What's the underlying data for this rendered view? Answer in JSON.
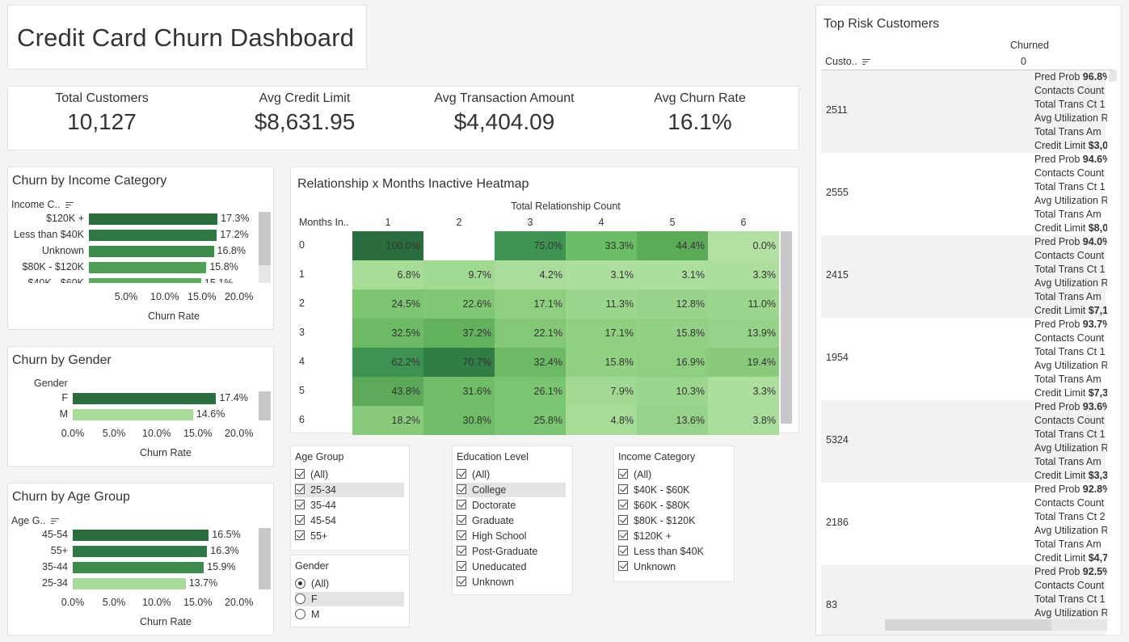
{
  "header": {
    "title": "Credit Card Churn Dashboard"
  },
  "kpis": [
    {
      "label": "Total Customers",
      "value": "10,127"
    },
    {
      "label": "Avg Credit Limit",
      "value": "$8,631.95"
    },
    {
      "label": "Avg Transaction Amount",
      "value": "$4,404.09"
    },
    {
      "label": "Avg Churn Rate",
      "value": "16.1%"
    }
  ],
  "income_chart": {
    "title": "Churn by Income Category",
    "dim_header": "Income C..",
    "axis_title": "Churn Rate",
    "ticks": [
      "5.0%",
      "10.0%",
      "15.0%",
      "20.0%"
    ],
    "rows": [
      {
        "label": "$120K +",
        "value": 17.3,
        "text": "17.3%",
        "color": "#2a6e3f"
      },
      {
        "label": "Less than $40K",
        "value": 17.2,
        "text": "17.2%",
        "color": "#2f7a44"
      },
      {
        "label": "Unknown",
        "value": 16.8,
        "text": "16.8%",
        "color": "#3c8c4b"
      },
      {
        "label": "$80K - $120K",
        "value": 15.8,
        "text": "15.8%",
        "color": "#4f9e55"
      },
      {
        "label": "$40K - $60K",
        "value": 15.1,
        "text": "15.1%",
        "color": "#5dab5e"
      }
    ]
  },
  "gender_chart": {
    "title": "Churn by Gender",
    "dim_header": "Gender",
    "axis_title": "Churn Rate",
    "ticks": [
      "0.0%",
      "5.0%",
      "10.0%",
      "15.0%",
      "20.0%"
    ],
    "rows": [
      {
        "label": "F",
        "value": 17.4,
        "text": "17.4%",
        "color": "#2a6e3f"
      },
      {
        "label": "M",
        "value": 14.6,
        "text": "14.6%",
        "color": "#a8dc9a"
      }
    ]
  },
  "age_chart": {
    "title": "Churn by Age Group",
    "dim_header": "Age G..",
    "axis_title": "Churn Rate",
    "ticks": [
      "0.0%",
      "5.0%",
      "10.0%",
      "15.0%",
      "20.0%"
    ],
    "rows": [
      {
        "label": "45-54",
        "value": 16.5,
        "text": "16.5%",
        "color": "#2a6e3f"
      },
      {
        "label": "55+",
        "value": 16.3,
        "text": "16.3%",
        "color": "#2f7a44"
      },
      {
        "label": "35-44",
        "value": 15.9,
        "text": "15.9%",
        "color": "#3c8c4b"
      },
      {
        "label": "25-34",
        "value": 13.7,
        "text": "13.7%",
        "color": "#a8dc9a"
      }
    ]
  },
  "heatmap": {
    "title": "Relationship x Months Inactive Heatmap",
    "col_title": "Total Relationship Count",
    "row_header": "Months In..",
    "columns": [
      "1",
      "2",
      "3",
      "4",
      "5",
      "6"
    ],
    "rows": [
      {
        "label": "0",
        "cells": [
          "100.0%",
          "",
          "75.0%",
          "33.3%",
          "44.4%",
          "0.0%"
        ]
      },
      {
        "label": "1",
        "cells": [
          "6.8%",
          "9.7%",
          "4.2%",
          "3.1%",
          "3.1%",
          "3.3%"
        ]
      },
      {
        "label": "2",
        "cells": [
          "24.5%",
          "22.6%",
          "17.1%",
          "11.3%",
          "12.8%",
          "11.0%"
        ]
      },
      {
        "label": "3",
        "cells": [
          "32.5%",
          "37.2%",
          "22.1%",
          "17.1%",
          "15.8%",
          "13.9%"
        ]
      },
      {
        "label": "4",
        "cells": [
          "62.2%",
          "70.7%",
          "32.4%",
          "15.8%",
          "16.9%",
          "19.4%"
        ]
      },
      {
        "label": "5",
        "cells": [
          "43.8%",
          "31.6%",
          "26.1%",
          "7.9%",
          "10.3%",
          "3.3%"
        ]
      },
      {
        "label": "6",
        "cells": [
          "18.2%",
          "30.8%",
          "25.8%",
          "4.8%",
          "13.6%",
          "3.8%"
        ]
      }
    ],
    "colors": [
      [
        "#2a6e3f",
        "#ffffff",
        "#3c9450",
        "#6cbe66",
        "#5aab58",
        "#b2e0a3"
      ],
      [
        "#a6dc96",
        "#a0d990",
        "#aadd9b",
        "#acde9d",
        "#acde9d",
        "#acde9d"
      ],
      [
        "#7cc671",
        "#80c873",
        "#8ecf80",
        "#9cd68d",
        "#98d48a",
        "#9cd68d"
      ],
      [
        "#6cba63",
        "#62b15c",
        "#82c875",
        "#8ecf80",
        "#92d184",
        "#96d388"
      ],
      [
        "#3c9450",
        "#2f7f45",
        "#6cba63",
        "#92d184",
        "#8ecf80",
        "#88cc7b"
      ],
      [
        "#5caa59",
        "#70bd68",
        "#7ac570",
        "#a2da93",
        "#9cd68d",
        "#acde9d"
      ],
      [
        "#88cc7b",
        "#70bd68",
        "#7ac570",
        "#a6dc96",
        "#96d388",
        "#aadd9b"
      ]
    ]
  },
  "filters": {
    "age": {
      "title": "Age Group",
      "items": [
        "(All)",
        "25-34",
        "35-44",
        "45-54",
        "55+"
      ]
    },
    "gender": {
      "title": "Gender",
      "items": [
        "(All)",
        "F",
        "M"
      ]
    },
    "education": {
      "title": "Education Level",
      "items": [
        "(All)",
        "College",
        "Doctorate",
        "Graduate",
        "High School",
        "Post-Graduate",
        "Uneducated",
        "Unknown"
      ]
    },
    "income": {
      "title": "Income Category",
      "items": [
        "(All)",
        "$40K - $60K",
        "$60K - $80K",
        "$80K - $120K",
        "$120K +",
        "Less than $40K",
        "Unknown"
      ]
    }
  },
  "risk": {
    "title": "Top Risk Customers",
    "col_header": "Churned",
    "col_value": "0",
    "row_header": "Custo..",
    "customers": [
      {
        "id": "2511",
        "lines": [
          [
            "Pred Prob ",
            "96.8%"
          ],
          [
            "Contacts Count",
            ""
          ],
          [
            "Total Trans Ct 1",
            ""
          ],
          [
            "Avg Utilization R",
            ""
          ],
          [
            "Total Trans Am",
            ""
          ],
          [
            "Credit Limit ",
            "$3,0"
          ]
        ]
      },
      {
        "id": "2555",
        "lines": [
          [
            "Pred Prob ",
            "94.6%"
          ],
          [
            "Contacts Count",
            ""
          ],
          [
            "Total Trans Ct 1",
            ""
          ],
          [
            "Avg Utilization R",
            ""
          ],
          [
            "Total Trans Am",
            ""
          ],
          [
            "Credit Limit ",
            "$8,0"
          ]
        ]
      },
      {
        "id": "2415",
        "lines": [
          [
            "Pred Prob ",
            "94.0%"
          ],
          [
            "Contacts Count",
            ""
          ],
          [
            "Total Trans Ct 1",
            ""
          ],
          [
            "Avg Utilization R",
            ""
          ],
          [
            "Total Trans Am",
            ""
          ],
          [
            "Credit Limit ",
            "$7,1"
          ]
        ]
      },
      {
        "id": "1954",
        "lines": [
          [
            "Pred Prob ",
            "93.7%"
          ],
          [
            "Contacts Count",
            ""
          ],
          [
            "Total Trans Ct 1",
            ""
          ],
          [
            "Avg Utilization R",
            ""
          ],
          [
            "Total Trans Am",
            ""
          ],
          [
            "Credit Limit ",
            "$7,3"
          ]
        ]
      },
      {
        "id": "5324",
        "lines": [
          [
            "Pred Prob ",
            "93.6%"
          ],
          [
            "Contacts Count",
            ""
          ],
          [
            "Total Trans Ct 1",
            ""
          ],
          [
            "Avg Utilization R",
            ""
          ],
          [
            "Total Trans Am",
            ""
          ],
          [
            "Credit Limit ",
            "$3,3"
          ]
        ]
      },
      {
        "id": "2186",
        "lines": [
          [
            "Pred Prob ",
            "92.8%"
          ],
          [
            "Contacts Count",
            ""
          ],
          [
            "Total Trans Ct 2",
            ""
          ],
          [
            "Avg Utilization R",
            ""
          ],
          [
            "Total Trans Am",
            ""
          ],
          [
            "Credit Limit ",
            "$4,7"
          ]
        ]
      },
      {
        "id": "83",
        "lines": [
          [
            "Pred Prob ",
            "92.5%"
          ],
          [
            "Contacts Count",
            ""
          ],
          [
            "Total Trans Ct 1",
            ""
          ],
          [
            "Avg Utilization R",
            ""
          ]
        ]
      }
    ]
  }
}
